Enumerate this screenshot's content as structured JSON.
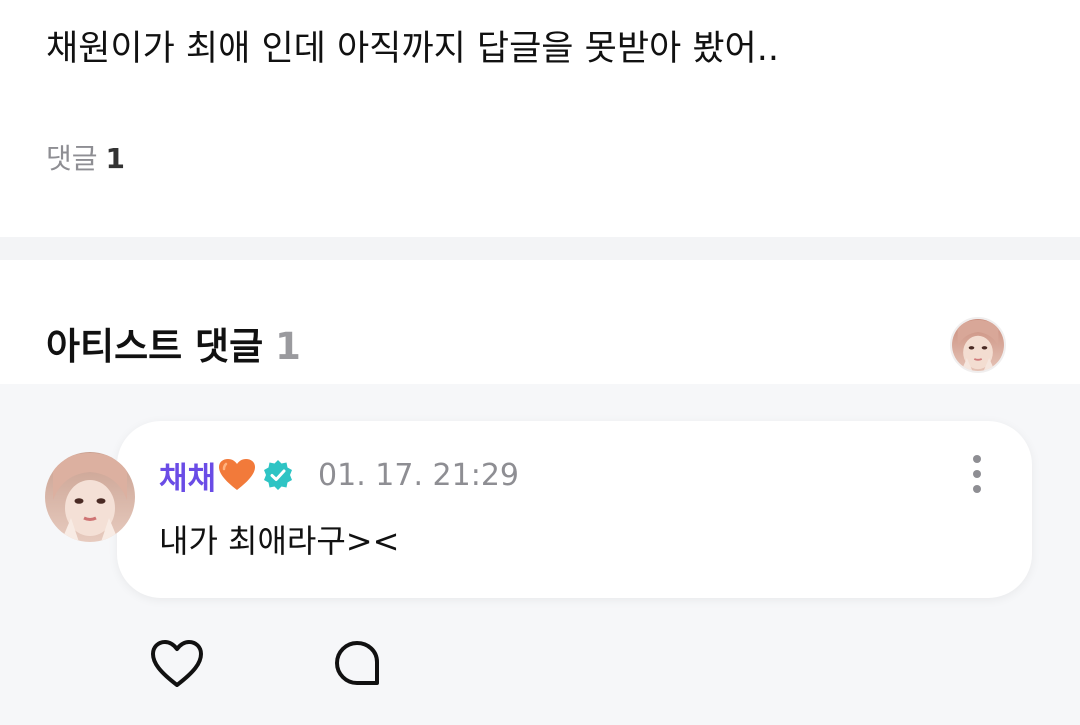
{
  "post": {
    "body": "채원이가 최애 인데 아직까지 답글을 못받아 봤어..",
    "comment_label": "댓글",
    "comment_count": "1"
  },
  "artist_comments": {
    "title": "아티스트 댓글",
    "count": "1",
    "header_avatar_icon": "artist-avatar-icon"
  },
  "comment": {
    "author": "채채",
    "author_emoji": "orange-heart-icon",
    "verified_icon": "verified-badge-icon",
    "timestamp": "01. 17. 21:29",
    "text": "내가 최애라구><",
    "avatar_icon": "artist-avatar-icon",
    "more_icon": "more-vertical-icon"
  },
  "actions": {
    "like_icon": "heart-outline-icon",
    "reply_icon": "speech-bubble-icon"
  },
  "colors": {
    "author_name": "#6a4ce6",
    "verified_badge": "#2ec4c4",
    "muted_text": "#8e8e93",
    "section_background": "#f6f7f9",
    "divider": "#f3f4f6",
    "heart_emoji": "#f27a3a"
  }
}
